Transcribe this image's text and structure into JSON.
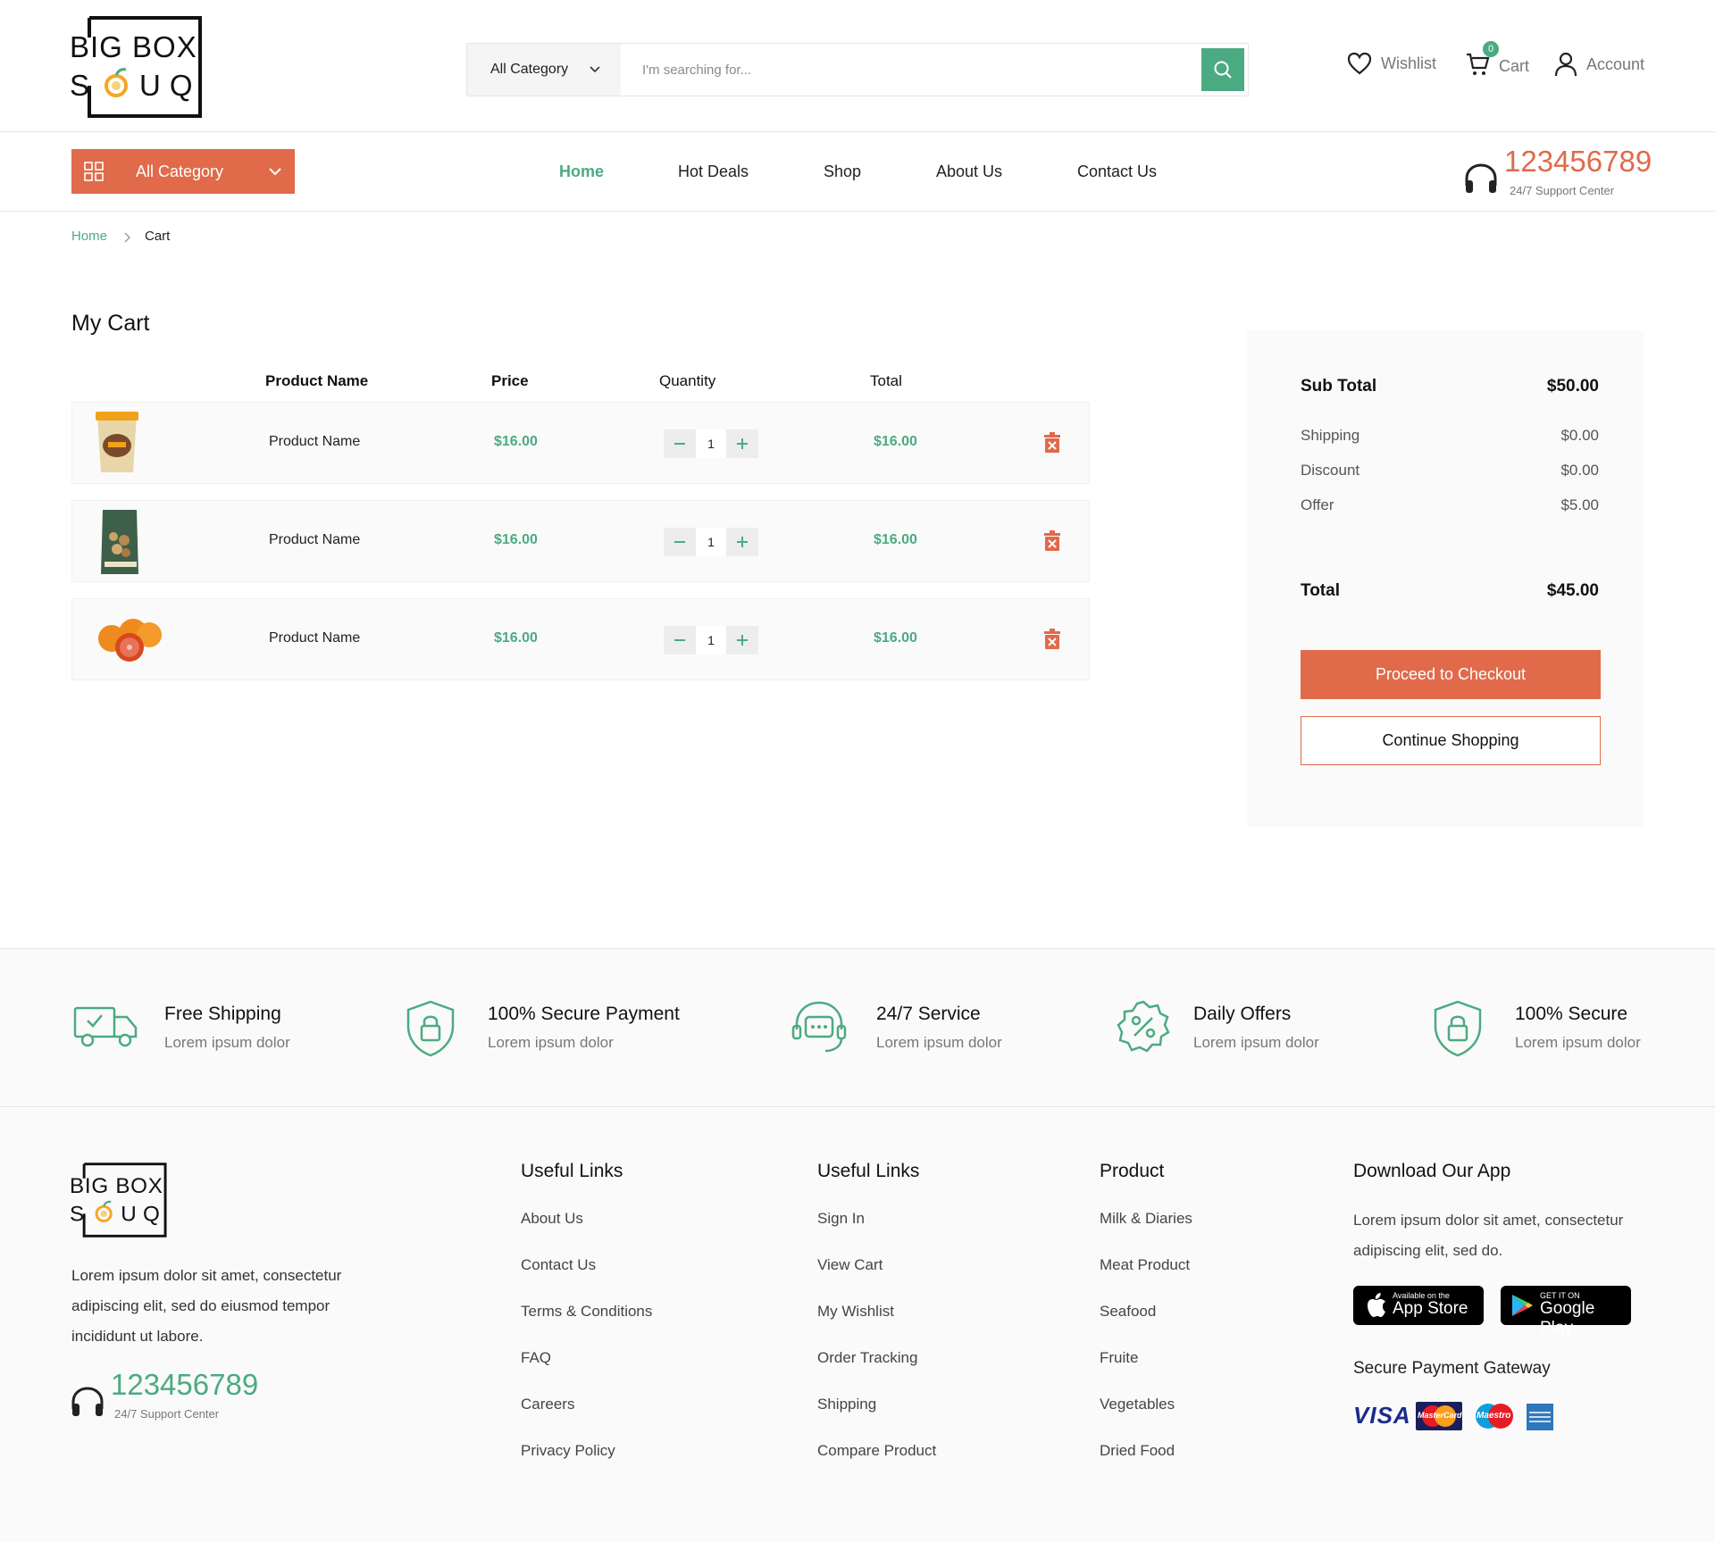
{
  "brand": {
    "line1": "BIG BOX",
    "line2": "SOUQ"
  },
  "search": {
    "category": "All Category",
    "placeholder": "I'm searching for..."
  },
  "header_links": {
    "wishlist": "Wishlist",
    "cart": "Cart",
    "cart_count": "0",
    "account": "Account"
  },
  "nav": {
    "all_category": "All Category",
    "items": [
      "Home",
      "Hot Deals",
      "Shop",
      "About Us",
      "Contact Us"
    ],
    "active": "Home",
    "support_number": "123456789",
    "support_label": "24/7 Support Center"
  },
  "breadcrumb": {
    "home": "Home",
    "current": "Cart"
  },
  "cart": {
    "title": "My Cart",
    "headers": {
      "product": "Product Name",
      "price": "Price",
      "quantity": "Quantity",
      "total": "Total"
    },
    "items": [
      {
        "image": "ice-cream-tub",
        "name": "Product Name",
        "price": "$16.00",
        "qty": "1",
        "total": "$16.00"
      },
      {
        "image": "nuts-pouch",
        "name": "Product Name",
        "price": "$16.00",
        "qty": "1",
        "total": "$16.00"
      },
      {
        "image": "oranges",
        "name": "Product Name",
        "price": "$16.00",
        "qty": "1",
        "total": "$16.00"
      }
    ]
  },
  "summary": {
    "subtotal_label": "Sub Total",
    "subtotal": "$50.00",
    "shipping_label": "Shipping",
    "shipping": "$0.00",
    "discount_label": "Discount",
    "discount": "$0.00",
    "offer_label": "Offer",
    "offer": "$5.00",
    "total_label": "Total",
    "total": "$45.00",
    "checkout": "Proceed to Checkout",
    "continue": "Continue Shopping"
  },
  "features": [
    {
      "icon": "truck-icon",
      "title": "Free Shipping",
      "sub": "Lorem ipsum dolor"
    },
    {
      "icon": "shield-lock-icon",
      "title": "100% Secure Payment",
      "sub": "Lorem ipsum dolor"
    },
    {
      "icon": "support-chat-icon",
      "title": "24/7 Service",
      "sub": "Lorem ipsum dolor"
    },
    {
      "icon": "discount-badge-icon",
      "title": "Daily Offers",
      "sub": "Lorem ipsum dolor"
    },
    {
      "icon": "shield-lock-icon",
      "title": "100% Secure",
      "sub": "Lorem ipsum dolor"
    }
  ],
  "footer": {
    "about": "Lorem ipsum dolor sit amet, consectetur adipiscing elit, sed do eiusmod tempor incididunt ut labore.",
    "support_number": "123456789",
    "support_label": "24/7 Support Center",
    "col1": {
      "title": "Useful Links",
      "links": [
        "About Us",
        "Contact Us",
        "Terms & Conditions",
        "FAQ",
        "Careers",
        "Privacy Policy"
      ]
    },
    "col2": {
      "title": "Useful Links",
      "links": [
        "Sign In",
        "View Cart",
        "My Wishlist",
        "Order Tracking",
        "Shipping",
        "Compare Product"
      ]
    },
    "col3": {
      "title": "Product",
      "links": [
        "Milk & Diaries",
        "Meat Product",
        "Seafood",
        "Fruite",
        "Vegetables",
        "Dried Food"
      ]
    },
    "app": {
      "title": "Download Our App",
      "text": "Lorem ipsum dolor sit amet, consectetur adipiscing elit, sed do.",
      "appstore_small": "Available on the",
      "appstore_big": "App Store",
      "google_small": "GET IT ON",
      "google_big": "Google Play"
    },
    "payment_title": "Secure Payment Gateway",
    "payment_methods": [
      "VISA",
      "MasterCard",
      "Maestro",
      "American Express"
    ]
  },
  "colors": {
    "accent_green": "#4caa82",
    "accent_orange": "#e06a4a"
  }
}
